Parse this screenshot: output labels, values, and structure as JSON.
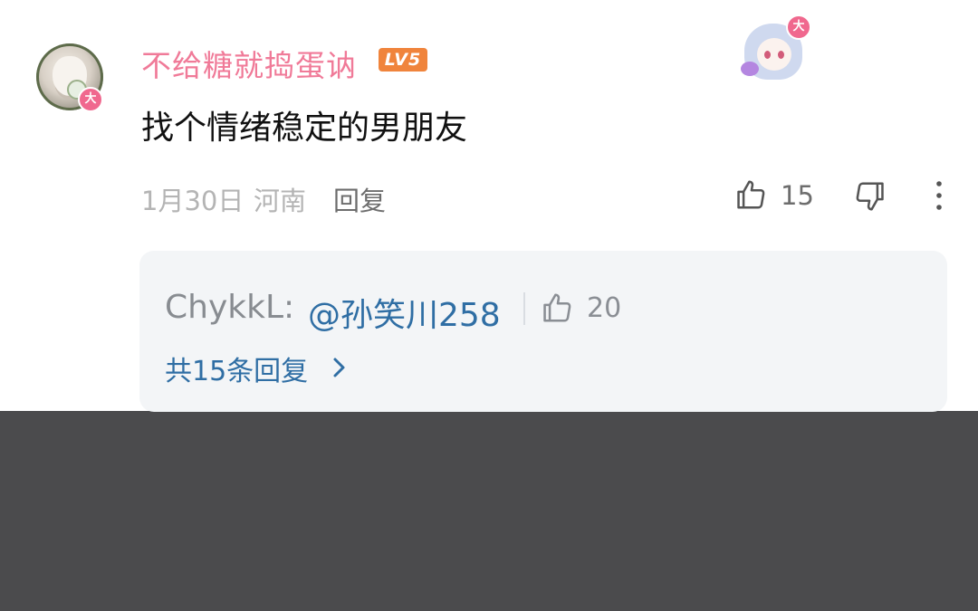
{
  "comment": {
    "username": "不给糖就捣蛋讷",
    "level": "LV5",
    "avatar_badge": "大",
    "op_badge": "大",
    "text": "找个情绪稳定的男朋友",
    "date": "1月30日",
    "region": "河南",
    "reply_label": "回复",
    "like_count": "15"
  },
  "reply_preview": {
    "author": "ChykkL:",
    "mention": "@孙笑川258",
    "like_count": "20",
    "more_replies_label": "共15条回复"
  },
  "colors": {
    "username": "#f07a98",
    "level_badge": "#f0843c",
    "link_blue": "#2f6ea4",
    "dim_gray": "#b4b4b4",
    "reply_box_bg": "#f3f5f7",
    "lower_overlay": "#4b4b4d"
  },
  "icons": {
    "like": "thumbs-up-icon",
    "dislike": "thumbs-down-icon",
    "more": "vertical-dots-icon",
    "expand": "chevron-right-icon"
  }
}
